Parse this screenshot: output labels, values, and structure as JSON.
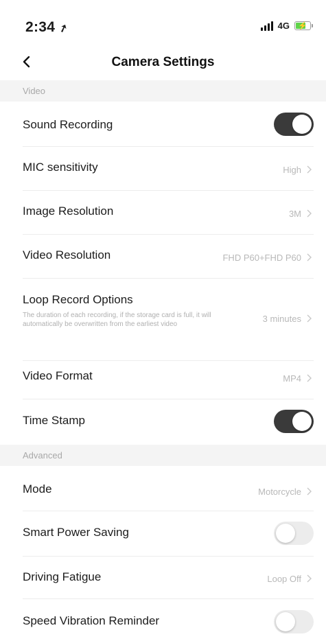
{
  "status_bar": {
    "time": "2:34",
    "location_glyph": "➚",
    "network": "4G",
    "battery_bolt": "⚡",
    "battery_level": 0.75,
    "battery_color": "#5fd34a"
  },
  "nav": {
    "title": "Camera Settings",
    "back_icon": "chevron-left-icon"
  },
  "sections": {
    "video": {
      "title": "Video"
    },
    "advanced": {
      "title": "Advanced"
    }
  },
  "rows": {
    "sound_recording": {
      "label": "Sound Recording",
      "toggle": true
    },
    "mic_sensitivity": {
      "label": "MIC sensitivity",
      "value": "High"
    },
    "image_resolution": {
      "label": "Image Resolution",
      "value": "3M"
    },
    "video_resolution": {
      "label": "Video Resolution",
      "value": "FHD P60+FHD P60"
    },
    "loop_record": {
      "label": "Loop Record Options",
      "description": "The duration of each recording, if the storage card is full, it will automatically be overwritten from the earliest video",
      "value": "3 minutes"
    },
    "video_format": {
      "label": "Video Format",
      "value": "MP4"
    },
    "time_stamp": {
      "label": "Time Stamp",
      "toggle": true
    },
    "mode": {
      "label": "Mode",
      "value": "Motorcycle"
    },
    "smart_power_saving": {
      "label": "Smart Power Saving",
      "toggle": false
    },
    "driving_fatigue": {
      "label": "Driving Fatigue",
      "value": "Loop Off"
    },
    "speed_vibration": {
      "label": "Speed Vibration Reminder",
      "toggle": false
    }
  },
  "colors": {
    "toggle_on": "#3a3a3a",
    "toggle_off": "#ececec",
    "section_bg": "#f4f4f4"
  }
}
